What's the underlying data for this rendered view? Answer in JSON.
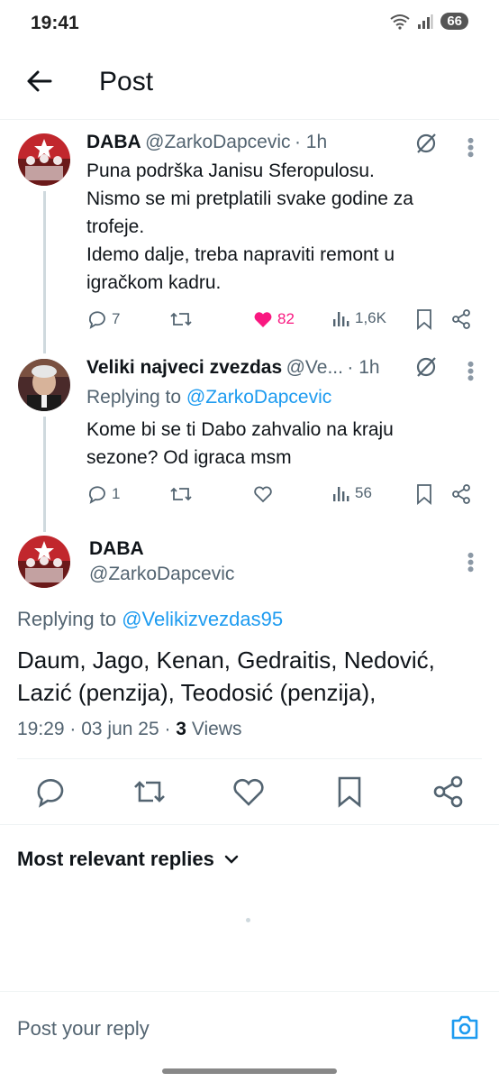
{
  "status": {
    "time": "19:41",
    "battery": "66"
  },
  "header": {
    "title": "Post"
  },
  "tweets": [
    {
      "name": "DABA",
      "handle": "@ZarkoDapcevic",
      "time": "· 1h",
      "text_lines": [
        "Puna podrška Janisu Sferopulosu.",
        "Nismo se mi pretplatili svake godine za",
        "trofeje.",
        "Idemo dalje, treba napraviti remont u",
        "igračkom kadru."
      ],
      "replies": "7",
      "likes": "82",
      "views": "1,6K"
    },
    {
      "name": "Veliki najveci zvezdas",
      "handle": "@Ve...",
      "time": "· 1h",
      "replying_prefix": "Replying to",
      "replying_to": "@ZarkoDapcevic",
      "text_lines": [
        "Kome bi se ti Dabo zahvalio na kraju",
        "sezone? Od igraca msm"
      ],
      "replies": "1",
      "views": "56"
    }
  ],
  "main_post": {
    "name": "DABA",
    "handle": "@ZarkoDapcevic",
    "replying_prefix": "Replying to",
    "replying_to": "@Velikizvezdas95",
    "text_lines": [
      "Daum, Jago, Kenan, Gedraitis, Nedović,",
      "Lazić (penzija), Teodosić (penzija),"
    ],
    "timestamp": "19:29 · 03 jun 25 ·",
    "views_count": "3",
    "views_label": "Views"
  },
  "sort": {
    "label": "Most relevant replies"
  },
  "composer": {
    "placeholder": "Post your reply"
  },
  "colors": {
    "accent": "#1d9bf0",
    "like": "#f91880",
    "muted": "#536471"
  }
}
